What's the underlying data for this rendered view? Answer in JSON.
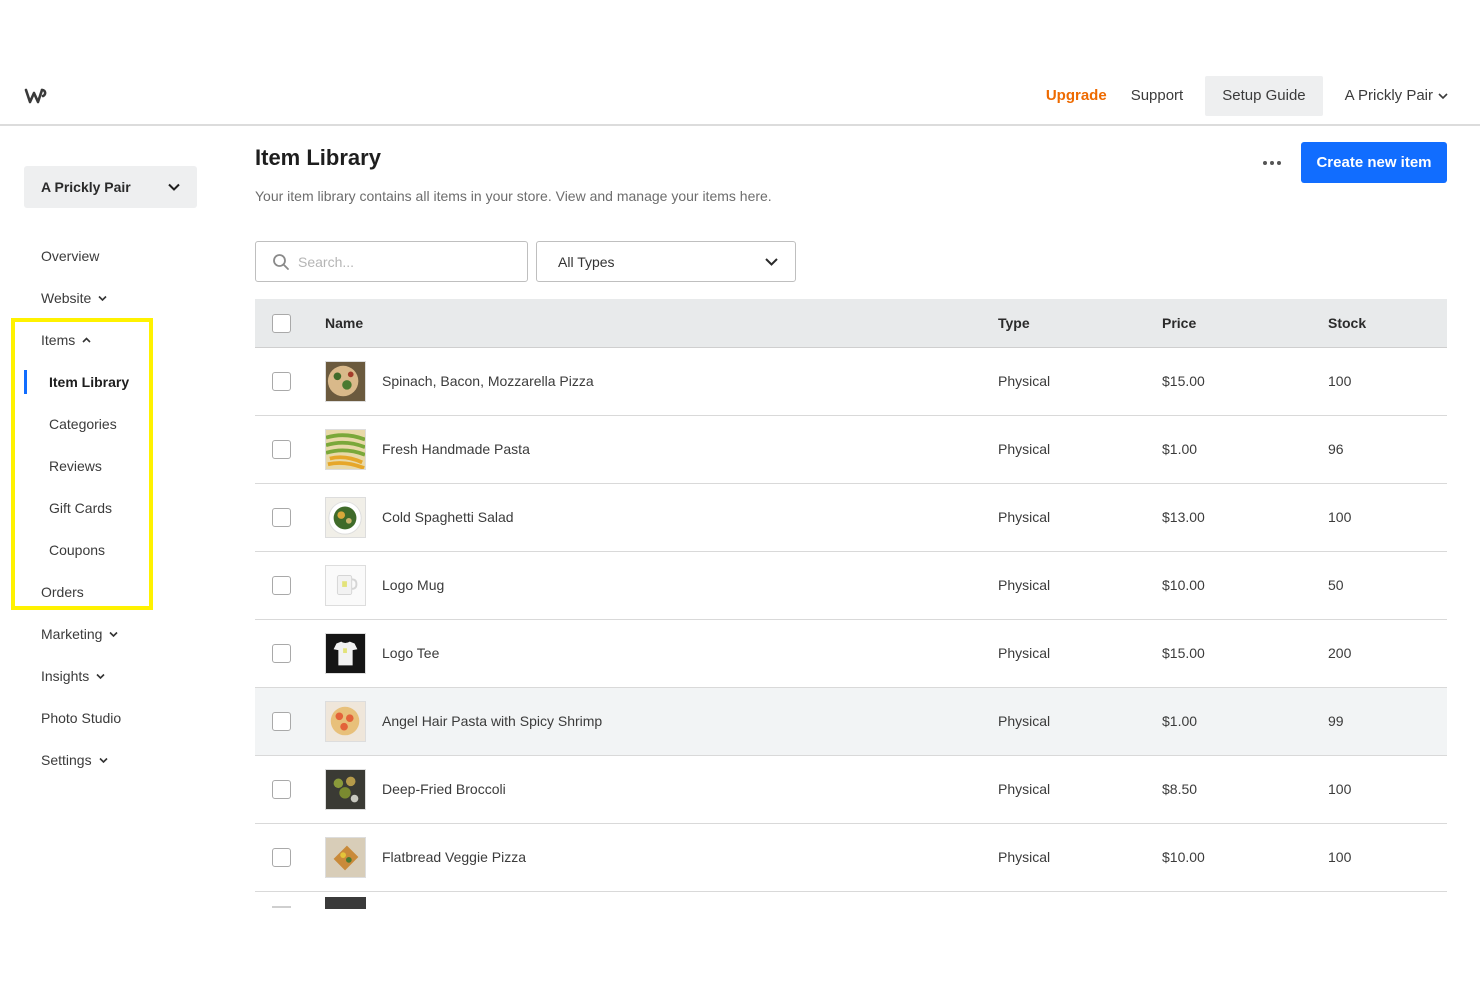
{
  "topbar": {
    "links": {
      "upgrade": "Upgrade",
      "support": "Support",
      "setup_guide": "Setup Guide",
      "account": "A Prickly Pair"
    }
  },
  "sidebar": {
    "site_name": "A Prickly Pair",
    "items": [
      {
        "label": "Overview"
      },
      {
        "label": "Website"
      },
      {
        "label": "Items"
      },
      {
        "label": "Item Library"
      },
      {
        "label": "Categories"
      },
      {
        "label": "Reviews"
      },
      {
        "label": "Gift Cards"
      },
      {
        "label": "Coupons"
      },
      {
        "label": "Orders"
      },
      {
        "label": "Marketing"
      },
      {
        "label": "Insights"
      },
      {
        "label": "Photo Studio"
      },
      {
        "label": "Settings"
      }
    ]
  },
  "main": {
    "title": "Item Library",
    "description": "Your item library contains all items in your store. View and manage your items here.",
    "create_button": "Create new item",
    "search_placeholder": "Search...",
    "type_filter": "All Types",
    "columns": {
      "name": "Name",
      "type": "Type",
      "price": "Price",
      "stock": "Stock"
    },
    "rows": [
      {
        "name": "Spinach, Bacon, Mozzarella Pizza",
        "type": "Physical",
        "price": "$15.00",
        "stock": "100"
      },
      {
        "name": "Fresh Handmade Pasta",
        "type": "Physical",
        "price": "$1.00",
        "stock": "96"
      },
      {
        "name": "Cold Spaghetti Salad",
        "type": "Physical",
        "price": "$13.00",
        "stock": "100"
      },
      {
        "name": "Logo Mug",
        "type": "Physical",
        "price": "$10.00",
        "stock": "50"
      },
      {
        "name": "Logo Tee",
        "type": "Physical",
        "price": "$15.00",
        "stock": "200"
      },
      {
        "name": "Angel Hair Pasta with Spicy Shrimp",
        "type": "Physical",
        "price": "$1.00",
        "stock": "99"
      },
      {
        "name": "Deep-Fried Broccoli",
        "type": "Physical",
        "price": "$8.50",
        "stock": "100"
      },
      {
        "name": "Flatbread Veggie Pizza",
        "type": "Physical",
        "price": "$10.00",
        "stock": "100"
      }
    ]
  },
  "colors": {
    "accent": "#116dff",
    "upgrade": "#ee6a00",
    "highlight": "#fff200"
  }
}
